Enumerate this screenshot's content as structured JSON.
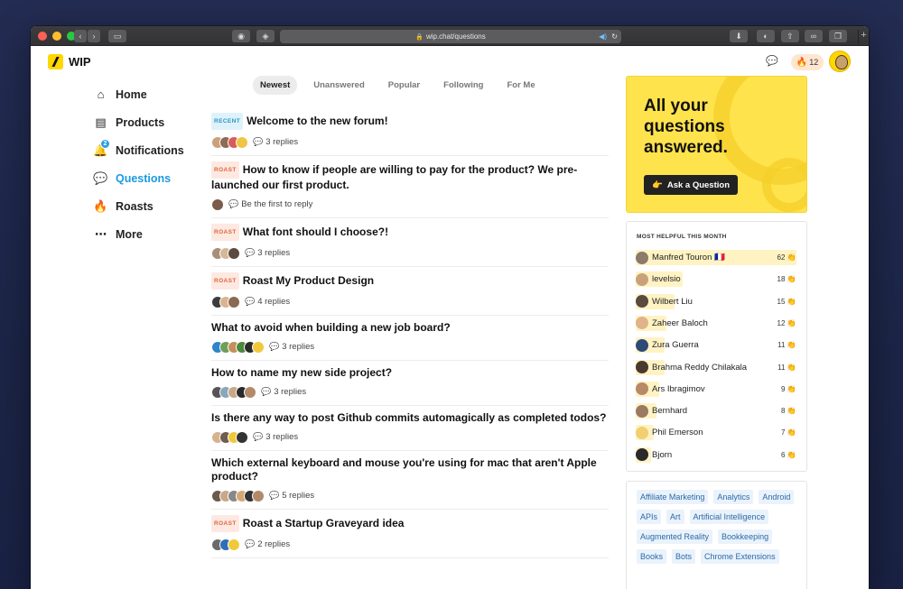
{
  "browser": {
    "url": "wip.chat/questions"
  },
  "app": {
    "name": "WIP",
    "streak": "12"
  },
  "nav": [
    {
      "label": "Home",
      "icon": "home-icon",
      "active": false
    },
    {
      "label": "Products",
      "icon": "products-icon",
      "active": false
    },
    {
      "label": "Notifications",
      "icon": "bell-icon",
      "active": false,
      "badge": "2"
    },
    {
      "label": "Questions",
      "icon": "questions-icon",
      "active": true
    },
    {
      "label": "Roasts",
      "icon": "fire-icon",
      "active": false
    },
    {
      "label": "More",
      "icon": "more-icon",
      "active": false
    }
  ],
  "tabs": [
    {
      "label": "Newest",
      "active": true
    },
    {
      "label": "Unanswered",
      "active": false
    },
    {
      "label": "Popular",
      "active": false
    },
    {
      "label": "Following",
      "active": false
    },
    {
      "label": "For Me",
      "active": false
    }
  ],
  "posts": [
    {
      "tag": "RECENT",
      "title": "Welcome to the new forum!",
      "replies": "3 replies",
      "avatars": [
        "#c9a27b",
        "#8d6b55",
        "#d95b5b",
        "#f0c445"
      ]
    },
    {
      "tag": "ROAST",
      "title": "How to know if people are willing to pay for the product? We pre-launched our first product.",
      "replies": "Be the first to reply",
      "avatars": [
        "#7b5b4a"
      ]
    },
    {
      "tag": "ROAST",
      "title": "What font should I choose?!",
      "replies": "3 replies",
      "avatars": [
        "#a88f7a",
        "#d7b79a",
        "#5c4a3f"
      ]
    },
    {
      "tag": "ROAST",
      "title": "Roast My Product Design",
      "replies": "4 replies",
      "avatars": [
        "#3c3c3c",
        "#d9b48f",
        "#8a6a52"
      ]
    },
    {
      "tag": "",
      "title": "What to avoid when building a new job board?",
      "replies": "3 replies",
      "avatars": [
        "#2e85c9",
        "#6e9e5a",
        "#c48f5a",
        "#4a8a3a",
        "#2a2a2a",
        "#f0c93a"
      ]
    },
    {
      "tag": "",
      "title": "How to name my new side project?",
      "replies": "3 replies",
      "avatars": [
        "#555",
        "#8aa6b8",
        "#c8a888",
        "#2a2a2a",
        "#b38a6a"
      ]
    },
    {
      "tag": "",
      "title": "Is there any way to post Github commits automagically as completed todos?",
      "replies": "3 replies",
      "avatars": [
        "#d6b28e",
        "#6f5c4f",
        "#f0c93a",
        "#333"
      ]
    },
    {
      "tag": "",
      "title": "Which external keyboard and mouse you're using for mac that aren't Apple product?",
      "replies": "5 replies",
      "avatars": [
        "#6a5a4a",
        "#c8a888",
        "#888",
        "#d4a874",
        "#333",
        "#b08a6a"
      ]
    },
    {
      "tag": "ROAST",
      "title": "Roast a Startup Graveyard idea",
      "replies": "2 replies",
      "avatars": [
        "#6a6a6a",
        "#2e6fb8",
        "#f0c93a"
      ]
    }
  ],
  "hero": {
    "title": "All your questions answered.",
    "button": "Ask a Question",
    "button_icon": "👉"
  },
  "helpful": {
    "heading": "MOST HELPFUL THIS MONTH",
    "leaders": [
      {
        "name": "Manfred Touron 🇫🇷",
        "score": 62,
        "color": "#8c7a6a"
      },
      {
        "name": "levelsio",
        "score": 18,
        "color": "#c9a27b"
      },
      {
        "name": "Wilbert Liu",
        "score": 15,
        "color": "#5a4a40"
      },
      {
        "name": "Zaheer Baloch",
        "score": 12,
        "color": "#e0b48a"
      },
      {
        "name": "Zura Guerra",
        "score": 11,
        "color": "#2e4a78"
      },
      {
        "name": "Brahma Reddy Chilakala",
        "score": 11,
        "color": "#4a3a2e"
      },
      {
        "name": "Ars Ibragimov",
        "score": 9,
        "color": "#b88a66"
      },
      {
        "name": "Bernhard",
        "score": 8,
        "color": "#9a7a60"
      },
      {
        "name": "Phil Emerson",
        "score": 7,
        "color": "#f0d070"
      },
      {
        "name": "Bjorn",
        "score": 6,
        "color": "#2a2a2a"
      }
    ],
    "max_score": 62,
    "clap_icon": "👏"
  },
  "topics": [
    "Affiliate Marketing",
    "Analytics",
    "Android",
    "APIs",
    "Art",
    "Artificial Intelligence",
    "Augmented Reality",
    "Bookkeeping",
    "Books",
    "Bots",
    "Chrome Extensions"
  ]
}
